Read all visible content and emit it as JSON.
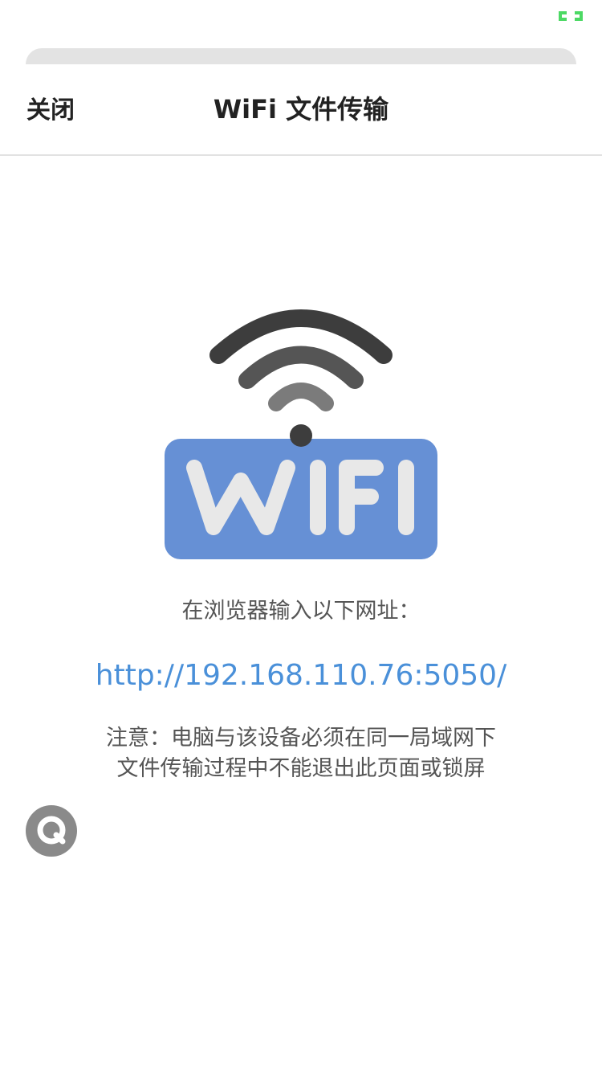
{
  "status_bar": {
    "indicator_icon": "fullscreen-indicator-icon",
    "indicator_color": "#4cd964"
  },
  "nav": {
    "close_label": "关闭",
    "title": "WiFi 文件传输"
  },
  "graphic": {
    "icon": "wifi-icon",
    "badge_text": "WIFI",
    "badge_color": "#6690d5",
    "wave_color": "#4a4a4a"
  },
  "content": {
    "instruction": "在浏览器输入以下网址：",
    "address": "http://192.168.110.76:5050/",
    "note_line1": "注意：电脑与该设备必须在同一局域网下",
    "note_line2": "文件传输过程中不能退出此页面或锁屏"
  },
  "float_button": {
    "icon": "search-icon"
  }
}
